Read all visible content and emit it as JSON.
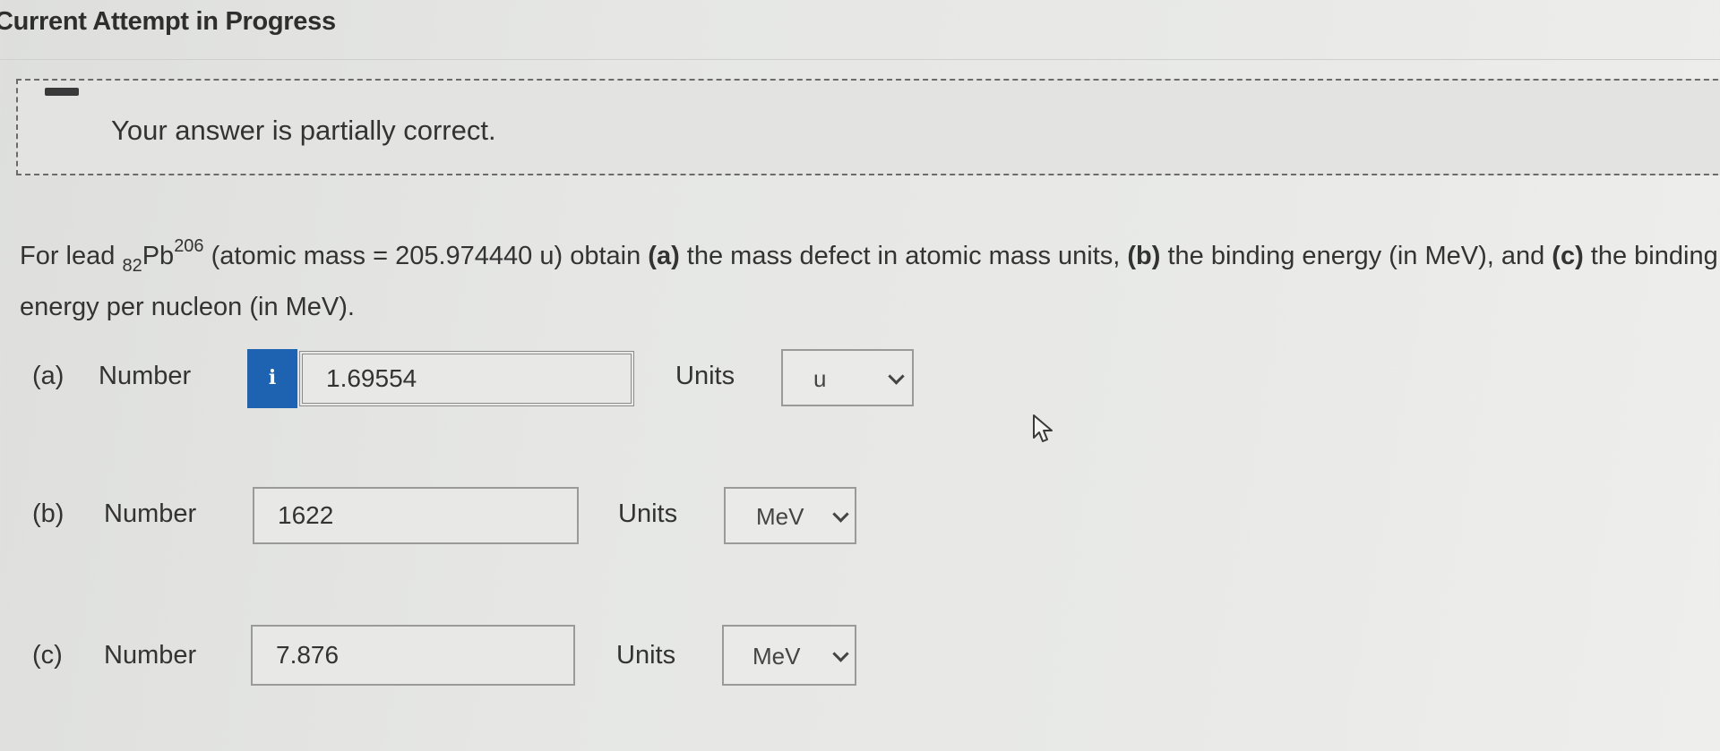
{
  "page": {
    "heading": "Current Attempt in Progress"
  },
  "feedback": {
    "icon": "minus-icon",
    "message": "Your answer is partially correct."
  },
  "question": {
    "prefix": "For lead ",
    "subscript": "82",
    "element": "Pb",
    "superscript": "206",
    "mid": " (atomic mass = 205.974440 u) obtain ",
    "part_a": "(a)",
    "text_a": " the mass defect in atomic mass units, ",
    "part_b": "(b)",
    "text_b": " the binding energy (in MeV), and ",
    "part_c": "(c)",
    "text_c": " the binding energy per nucleon (in MeV)."
  },
  "parts": [
    {
      "part_label": "(a)",
      "number_label": "Number",
      "info_icon": "info-icon",
      "value": "1.69554",
      "units_label": "Units",
      "units_value": "u"
    },
    {
      "part_label": "(b)",
      "number_label": "Number",
      "value": "1622",
      "units_label": "Units",
      "units_value": "MeV"
    },
    {
      "part_label": "(c)",
      "number_label": "Number",
      "value": "7.876",
      "units_label": "Units",
      "units_value": "MeV"
    }
  ],
  "colors": {
    "info_button": "#1d63b2",
    "background": "#e6e7e5",
    "text": "#333333"
  }
}
